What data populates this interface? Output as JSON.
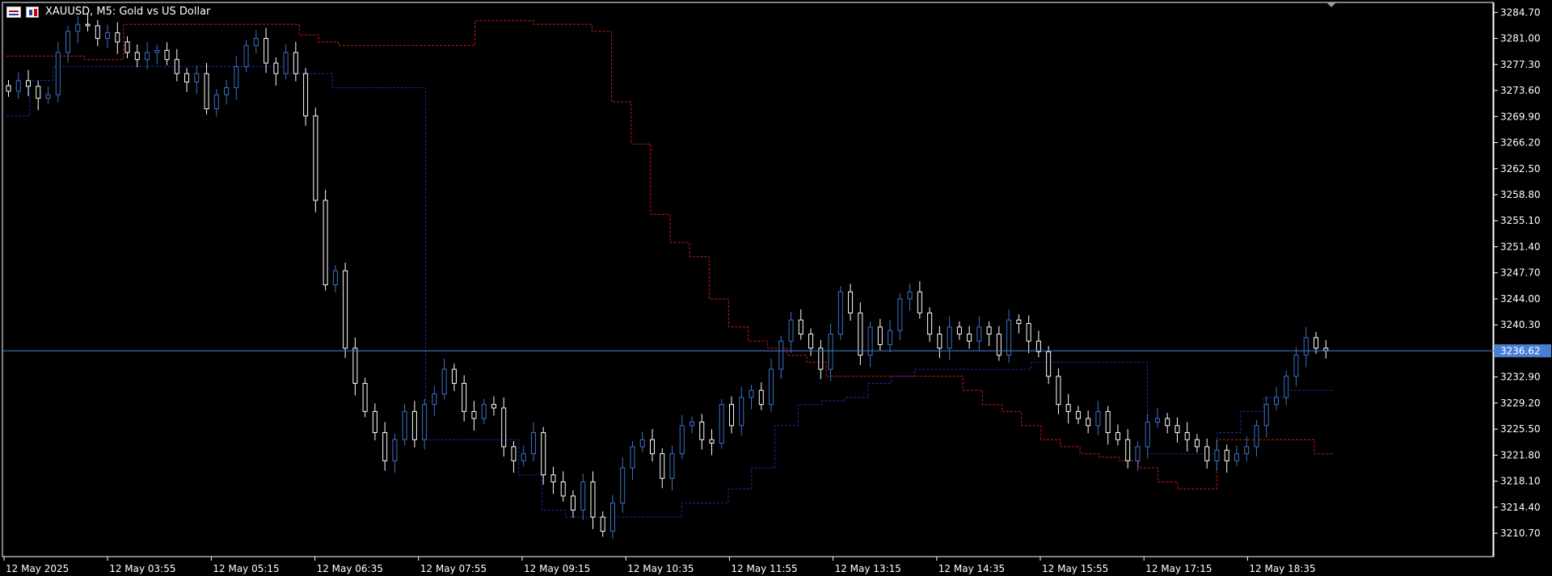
{
  "header": {
    "symbol_title": "XAUUSD, M5:  Gold vs US Dollar",
    "icon_left": "table-icon",
    "icon_right": "chart-icon"
  },
  "colors": {
    "background": "#000000",
    "grid_axis": "#ffffff",
    "bull_candle": "#3a72c8",
    "bear_candle": "#ffffff",
    "current_price_line": "#4a7fd6",
    "upper_trail": "#d21919",
    "lower_trail": "#1a2fa6"
  },
  "current_price": {
    "value": 3236.62,
    "label": "3236.62"
  },
  "chart_data": {
    "type": "candlestick",
    "title": "XAUUSD, M5:  Gold vs US Dollar",
    "y_range": [
      3207.5,
      3286.0
    ],
    "y_ticks": [
      3284.7,
      3281.0,
      3277.3,
      3273.6,
      3269.9,
      3266.2,
      3262.5,
      3258.8,
      3255.1,
      3251.4,
      3247.7,
      3244.0,
      3240.3,
      3236.62,
      3232.9,
      3229.2,
      3225.5,
      3221.8,
      3218.1,
      3214.4,
      3210.7
    ],
    "y_tick_labels": [
      "3284.70",
      "3281.00",
      "3277.30",
      "3273.60",
      "3269.90",
      "3266.20",
      "3262.50",
      "3258.80",
      "3255.10",
      "3251.40",
      "3247.70",
      "3244.00",
      "3240.30",
      "3236.62",
      "3232.90",
      "3229.20",
      "3225.50",
      "3221.80",
      "3218.10",
      "3214.40",
      "3210.70"
    ],
    "x_tick_labels": [
      "12 May 2025",
      "12 May 03:55",
      "12 May 05:15",
      "12 May 06:35",
      "12 May 07:55",
      "12 May 09:15",
      "12 May 10:35",
      "12 May 11:55",
      "12 May 13:15",
      "12 May 14:35",
      "12 May 15:55",
      "12 May 17:15",
      "12 May 18:35"
    ],
    "close_points": [
      3273.5,
      3275.0,
      3274.2,
      3272.5,
      3273.0,
      3279.0,
      3282.0,
      3283.0,
      3282.8,
      3281.0,
      3281.8,
      3280.5,
      3279.0,
      3278.0,
      3279.0,
      3279.3,
      3278.0,
      3276.0,
      3274.8,
      3276.0,
      3271.0,
      3273.0,
      3274.0,
      3277.0,
      3280.0,
      3281.0,
      3277.5,
      3276.0,
      3279.0,
      3276.0,
      3270.0,
      3258.0,
      3246.0,
      3248.0,
      3237.0,
      3232.0,
      3228.0,
      3225.0,
      3221.0,
      3224.0,
      3228.0,
      3224.0,
      3229.0,
      3230.5,
      3234.0,
      3232.0,
      3228.0,
      3227.0,
      3229.0,
      3228.5,
      3223.0,
      3221.0,
      3222.0,
      3225.0,
      3219.0,
      3218.0,
      3216.0,
      3214.0,
      3218.0,
      3213.0,
      3211.0,
      3215.0,
      3220.0,
      3223.0,
      3224.0,
      3222.0,
      3218.5,
      3222.0,
      3226.0,
      3226.5,
      3224.0,
      3223.5,
      3229.0,
      3226.0,
      3230.0,
      3231.0,
      3229.0,
      3234.0,
      3238.0,
      3241.0,
      3239.0,
      3237.0,
      3234.0,
      3239.0,
      3245.0,
      3242.0,
      3236.0,
      3240.0,
      3237.5,
      3239.5,
      3244.0,
      3245.0,
      3242.0,
      3239.0,
      3237.0,
      3240.0,
      3239.0,
      3238.0,
      3240.0,
      3239.0,
      3236.0,
      3241.0,
      3240.5,
      3238.0,
      3236.5,
      3233.0,
      3229.0,
      3228.0,
      3227.0,
      3226.0,
      3228.0,
      3225.0,
      3224.0,
      3221.0,
      3223.0,
      3226.5,
      3227.0,
      3226.0,
      3225.0,
      3224.0,
      3223.0,
      3221.0,
      3222.5,
      3221.0,
      3222.0,
      3223.0,
      3226.0,
      3229.0,
      3230.0,
      3233.0,
      3236.0,
      3238.5,
      3237.0,
      3236.62
    ],
    "upper_trail": [
      3278.5,
      3278.5,
      3278.5,
      3278.5,
      3278.0,
      3278.0,
      3283.0,
      3283.0,
      3283.0,
      3283.0,
      3283.0,
      3283.0,
      3283.0,
      3283.0,
      3283.0,
      3281.5,
      3280.5,
      3280.0,
      3280.0,
      3280.0,
      3280.0,
      3280.0,
      3280.0,
      3280.0,
      3283.5,
      3283.5,
      3283.5,
      3283.0,
      3283.0,
      3283.0,
      3282.0,
      3272.0,
      3266.0,
      3256.0,
      3252.0,
      3250.0,
      3244.0,
      3240.0,
      3238.0,
      3237.0,
      3236.0,
      3235.0,
      3233.0,
      3233.0,
      3233.0,
      3233.0,
      3233.0,
      3233.0,
      3233.0,
      3231.0,
      3229.0,
      3228.0,
      3226.0,
      3224.0,
      3223.0,
      3222.0,
      3221.5,
      3221.0,
      3220.0,
      3218.0,
      3217.0,
      3217.0,
      3224.0,
      3224.0,
      3224.0,
      3224.0,
      3224.0,
      3222.0
    ],
    "lower_trail": [
      3270.0,
      3275.0,
      3277.0,
      3277.0,
      3277.0,
      3277.0,
      3277.0,
      3277.0,
      3277.0,
      3277.0,
      3277.0,
      3277.0,
      3276.0,
      3276.0,
      3274.0,
      3274.0,
      3274.0,
      3274.0,
      3224.0,
      3224.0,
      3224.0,
      3224.0,
      3219.0,
      3214.0,
      3213.0,
      3213.0,
      3213.0,
      3213.0,
      3213.0,
      3215.0,
      3215.0,
      3217.0,
      3220.0,
      3226.0,
      3229.0,
      3229.5,
      3230.0,
      3232.0,
      3233.0,
      3234.0,
      3234.0,
      3234.0,
      3234.0,
      3234.0,
      3235.0,
      3235.0,
      3235.0,
      3235.0,
      3235.0,
      3222.0,
      3222.0,
      3222.0,
      3225.0,
      3228.0,
      3230.0,
      3231.0,
      3231.0
    ]
  }
}
